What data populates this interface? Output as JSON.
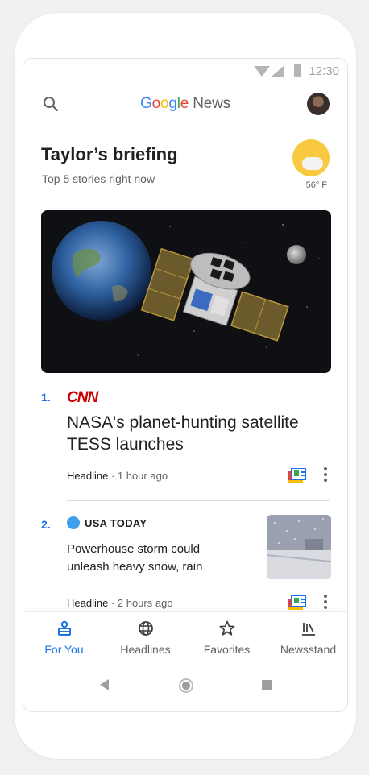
{
  "status_bar": {
    "time": "12:30"
  },
  "app_bar": {
    "logo": {
      "g1": "G",
      "o1": "o",
      "o2": "o",
      "g2": "g",
      "l": "l",
      "e": "e",
      "news": "News"
    }
  },
  "briefing": {
    "title": "Taylor’s briefing",
    "subtitle": "Top 5 stories right now",
    "weather": {
      "temp": "56° F"
    }
  },
  "stories": [
    {
      "rank": "1.",
      "source": "CNN",
      "title": "NASA's planet-hunting satellite TESS launches",
      "label": "Headline",
      "time": " · 1 hour ago"
    },
    {
      "rank": "2.",
      "source": "USA TODAY",
      "title": "Powerhouse storm could unleash heavy snow, rain",
      "label": "Headline",
      "time": " · 2 hours ago"
    }
  ],
  "bottom_nav": [
    {
      "label": "For You",
      "active": true
    },
    {
      "label": "Headlines"
    },
    {
      "label": "Favorites"
    },
    {
      "label": "Newsstand"
    }
  ],
  "colors": {
    "accent": "#1a73e8",
    "cnn": "#cc0000",
    "usa_today": "#3fa0f0",
    "weather": "#f9c940"
  }
}
